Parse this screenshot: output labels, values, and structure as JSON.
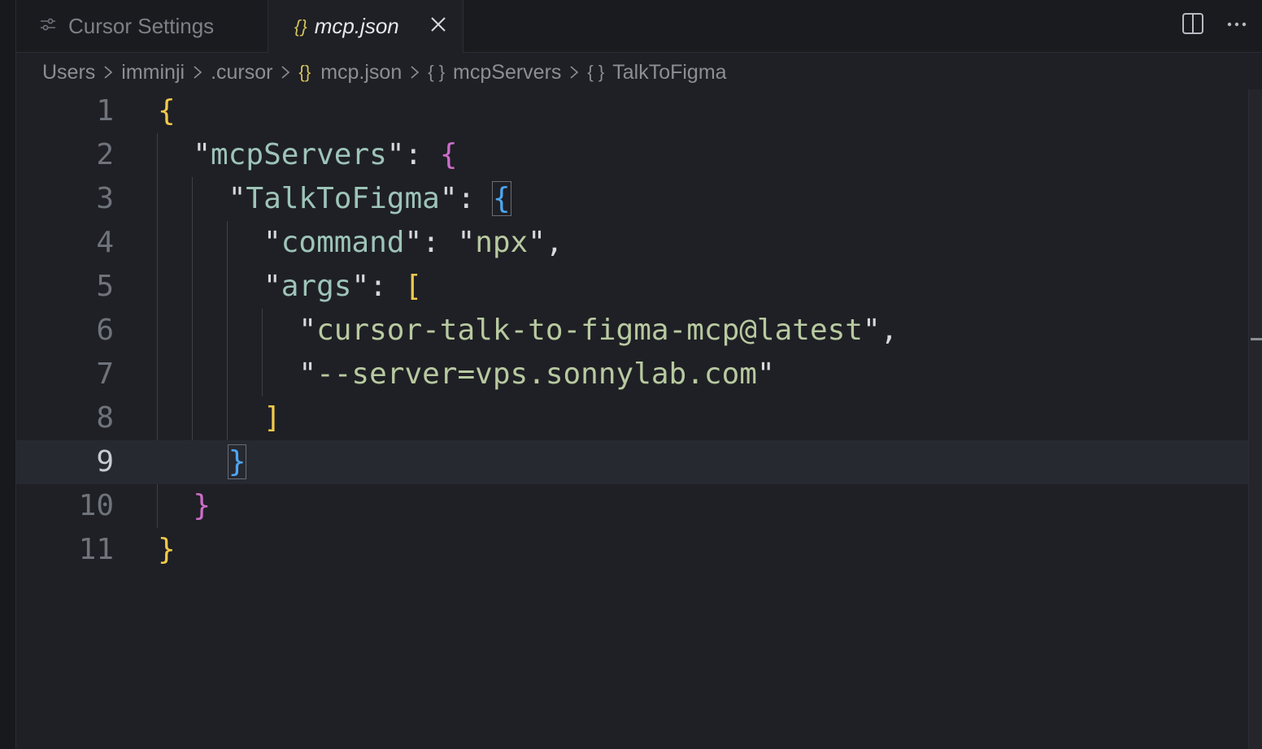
{
  "tabs": [
    {
      "label": "Cursor Settings",
      "icon": "settings-sliders-icon",
      "active": false
    },
    {
      "label": "mcp.json",
      "icon": "json-braces-icon",
      "active": true
    }
  ],
  "tab_json_icon_glyph": "{}",
  "breadcrumb": {
    "users": "Users",
    "imminji": "imminji",
    "cursor": ".cursor",
    "file": "mcp.json",
    "mcpServers": "mcpServers",
    "talkToFigma": "TalkToFigma",
    "json_glyph": "{}",
    "object_glyph": "{ }"
  },
  "code": {
    "line_numbers": [
      "1",
      "2",
      "3",
      "4",
      "5",
      "6",
      "7",
      "8",
      "9",
      "10",
      "11"
    ],
    "current_line": 9,
    "key_mcpServers": "mcpServers",
    "key_talkToFigma": "TalkToFigma",
    "key_command": "command",
    "val_command": "npx",
    "key_args": "args",
    "arg_0": "cursor-talk-to-figma-mcp@latest",
    "arg_1": "--server=vps.sonnylab.com"
  },
  "colors": {
    "background": "#1f2025",
    "bracket_level1": "#f2c94c",
    "bracket_level2": "#cc6ec9",
    "bracket_level3": "#4ea6f0",
    "key": "#9dc4b8",
    "string": "#b8c9a0",
    "json_icon": "#d6c45a"
  }
}
